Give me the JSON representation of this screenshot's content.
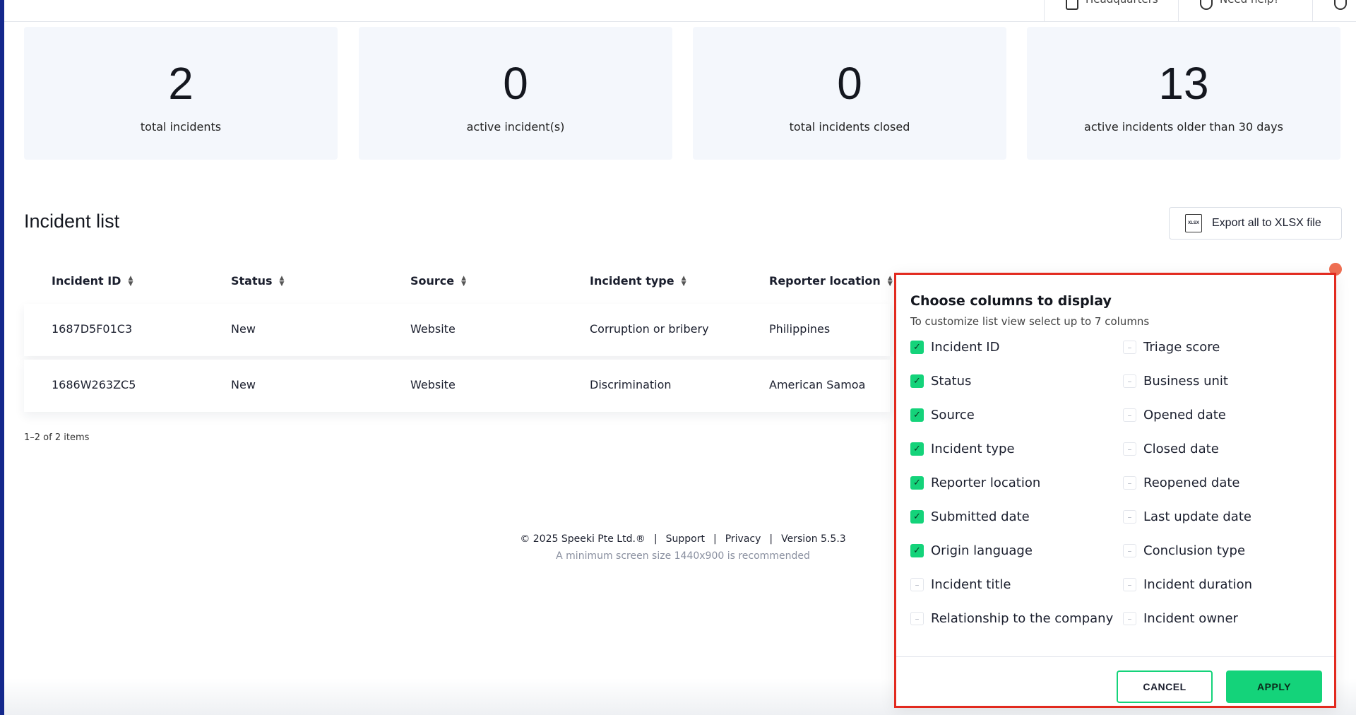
{
  "topbar": {
    "location_label": "Headquarters",
    "help_label": "Need help?"
  },
  "stats": [
    {
      "value": "2",
      "label": "total incidents"
    },
    {
      "value": "0",
      "label": "active incident(s)"
    },
    {
      "value": "0",
      "label": "total incidents closed"
    },
    {
      "value": "13",
      "label": "active incidents older than 30 days"
    }
  ],
  "incident_list": {
    "title": "Incident list",
    "export_label": "Export all to XLSX file",
    "export_icon_text": "XLSX",
    "columns": [
      "Incident ID",
      "Status",
      "Source",
      "Incident type",
      "Reporter location"
    ],
    "rows": [
      [
        "1687D5F01C3",
        "New",
        "Website",
        "Corruption or bribery",
        "Philippines"
      ],
      [
        "1686W263ZC5",
        "New",
        "Website",
        "Discrimination",
        "American Samoa"
      ]
    ],
    "pager": "1–2 of 2 items"
  },
  "footer": {
    "copyright": "© 2025 Speeki Pte Ltd.®",
    "support": "Support",
    "privacy": "Privacy",
    "version": "Version 5.5.3",
    "sep": "|",
    "note": "A minimum screen size 1440x900 is recommended"
  },
  "column_picker": {
    "title": "Choose columns to display",
    "subtitle": "To customize list view select up to 7 columns",
    "left_options": [
      {
        "label": "Incident ID",
        "checked": true
      },
      {
        "label": "Status",
        "checked": true
      },
      {
        "label": "Source",
        "checked": true
      },
      {
        "label": "Incident type",
        "checked": true
      },
      {
        "label": "Reporter location",
        "checked": true
      },
      {
        "label": "Submitted date",
        "checked": true
      },
      {
        "label": "Origin language",
        "checked": true
      },
      {
        "label": "Incident title",
        "checked": false
      },
      {
        "label": "Relationship to the company",
        "checked": false
      }
    ],
    "right_options": [
      {
        "label": "Triage score",
        "checked": false
      },
      {
        "label": "Business unit",
        "checked": false
      },
      {
        "label": "Opened date",
        "checked": false
      },
      {
        "label": "Closed date",
        "checked": false
      },
      {
        "label": "Reopened date",
        "checked": false
      },
      {
        "label": "Last update date",
        "checked": false
      },
      {
        "label": "Conclusion type",
        "checked": false
      },
      {
        "label": "Incident duration",
        "checked": false
      },
      {
        "label": "Incident owner",
        "checked": false
      }
    ],
    "cancel_label": "CANCEL",
    "apply_label": "APPLY"
  },
  "colors": {
    "accent_green": "#14d37a",
    "highlight_red": "#e22a1f",
    "sidebar_blue": "#14288c",
    "notification": "#ef6f53"
  }
}
